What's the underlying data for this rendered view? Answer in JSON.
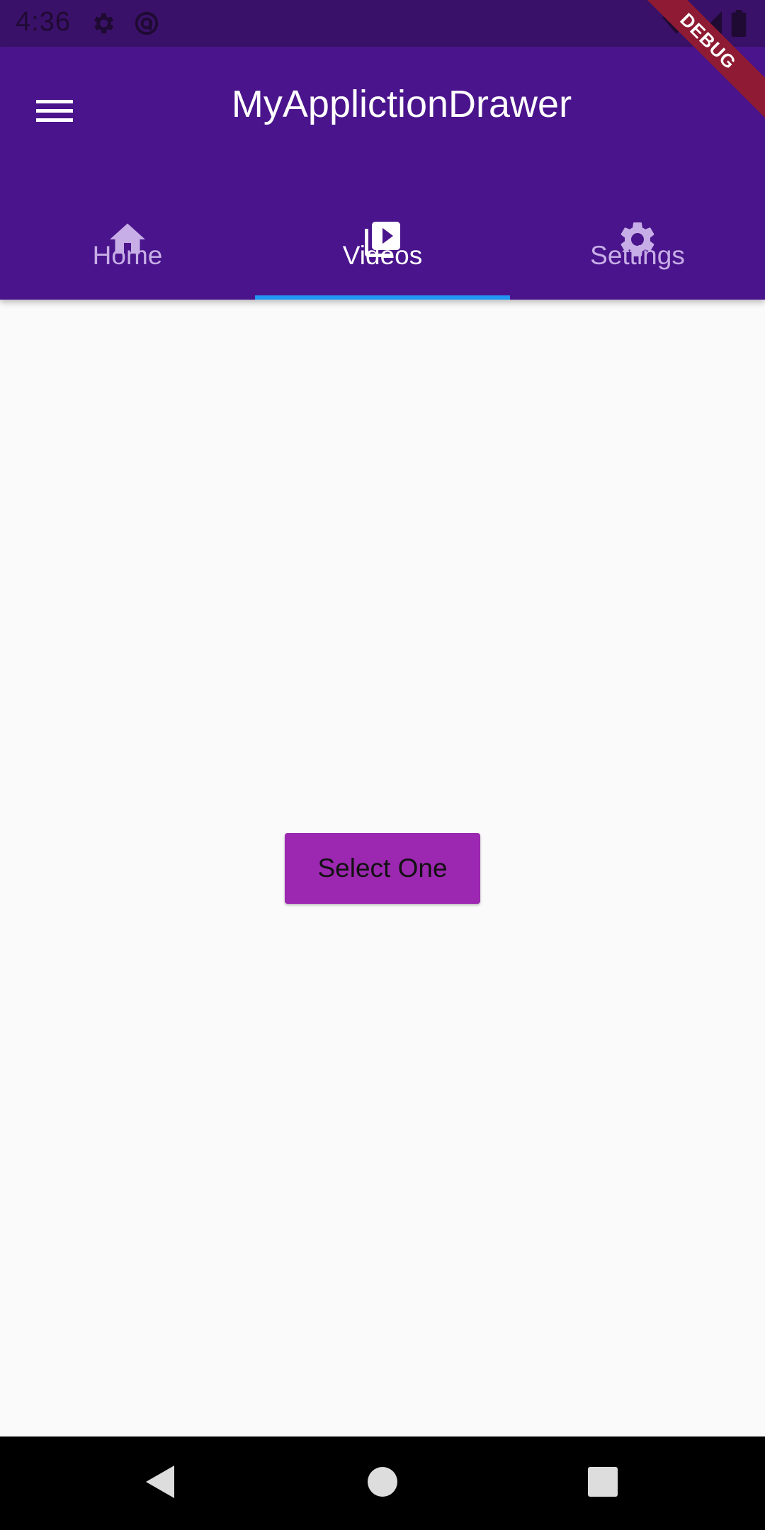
{
  "status_bar": {
    "time": "4:36",
    "icons": [
      "gear-icon",
      "circle-a-icon",
      "wifi-icon",
      "signal-icon",
      "battery-icon"
    ]
  },
  "app_bar": {
    "title": "MyApplictionDrawer",
    "menu_icon": "hamburger-menu-icon"
  },
  "tabs": [
    {
      "label": "Home",
      "icon": "home-icon",
      "active": false
    },
    {
      "label": "Videos",
      "icon": "video-library-icon",
      "active": true
    },
    {
      "label": "Settings",
      "icon": "gear-icon",
      "active": false
    }
  ],
  "debug_banner": "DEBUG",
  "content": {
    "button_label": "Select One"
  },
  "nav_bar": {
    "icons": [
      "back-icon",
      "home-circle-icon",
      "recents-square-icon"
    ]
  },
  "colors": {
    "primary": "#4A148C",
    "status_bar": "#3A1168",
    "indicator": "#2196F3",
    "button": "#9C27B0",
    "background": "#FAFAFA"
  }
}
